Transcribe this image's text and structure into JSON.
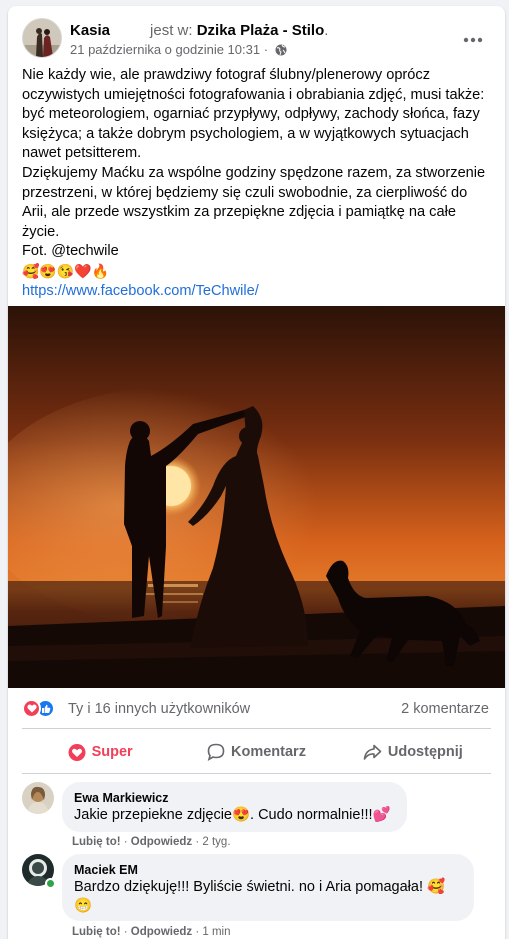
{
  "post": {
    "author": "Kasia",
    "checkin_prefix": "jest w:",
    "place": "Dzika Plaża - Stilo",
    "place_suffix": ".",
    "timestamp": "21 października o godzinie 10:31",
    "separator": "·",
    "paragraph1": "Nie każdy wie, ale prawdziwy fotograf ślubny/plenerowy oprócz oczywistych umiejętności fotografowania i obrabiania zdjęć, musi także: być meteorologiem, ogarniać przypływy, odpływy, zachody słońca, fazy księżyca; a także dobrym psychologiem, a w wyjątkowych sytuacjach nawet petsitterem.",
    "paragraph2": "Dziękujemy Maćku za wspólne godziny spędzone razem, za stworzenie przestrzeni, w której będziemy się czuli swobodnie, za cierpliwość do Arii, ale przede wszystkim za przepiękne zdjęcia i pamiątkę na całe życie.",
    "credit": "Fot. @techwile",
    "emojis": "🥰😍😘❤️🔥",
    "link": "https://www.facebook.com/TeChwile/",
    "photo_icon": "sunset-silhouette-photo"
  },
  "reactions": {
    "summary": "Ty i 16 innych użytkowników",
    "comments_count": "2 komentarze",
    "icons": [
      "love-reaction-icon",
      "like-reaction-icon"
    ]
  },
  "actions": {
    "super": "Super",
    "comment": "Komentarz",
    "share": "Udostępnij"
  },
  "comments": [
    {
      "author": "Ewa Markiewicz",
      "text": "Jakie przepiekne zdjęcie😍. Cudo normalnie!!!💕",
      "like": "Lubię to!",
      "reply": "Odpowiedz",
      "dot": "·",
      "time": "2 tyg."
    },
    {
      "author": "Maciek EM",
      "text_line1": "Bardzo dziękuję!!! Byliście świetni. no i Aria pomagała! 🥰",
      "text_line2": "😁",
      "like": "Lubię to!",
      "reply": "Odpowiedz",
      "dot": "·",
      "time": "1 min"
    }
  ],
  "colors": {
    "link": "#216fdb",
    "super": "#f33e58",
    "like": "#1877f2",
    "muted": "#65676b",
    "online": "#31a24c"
  }
}
